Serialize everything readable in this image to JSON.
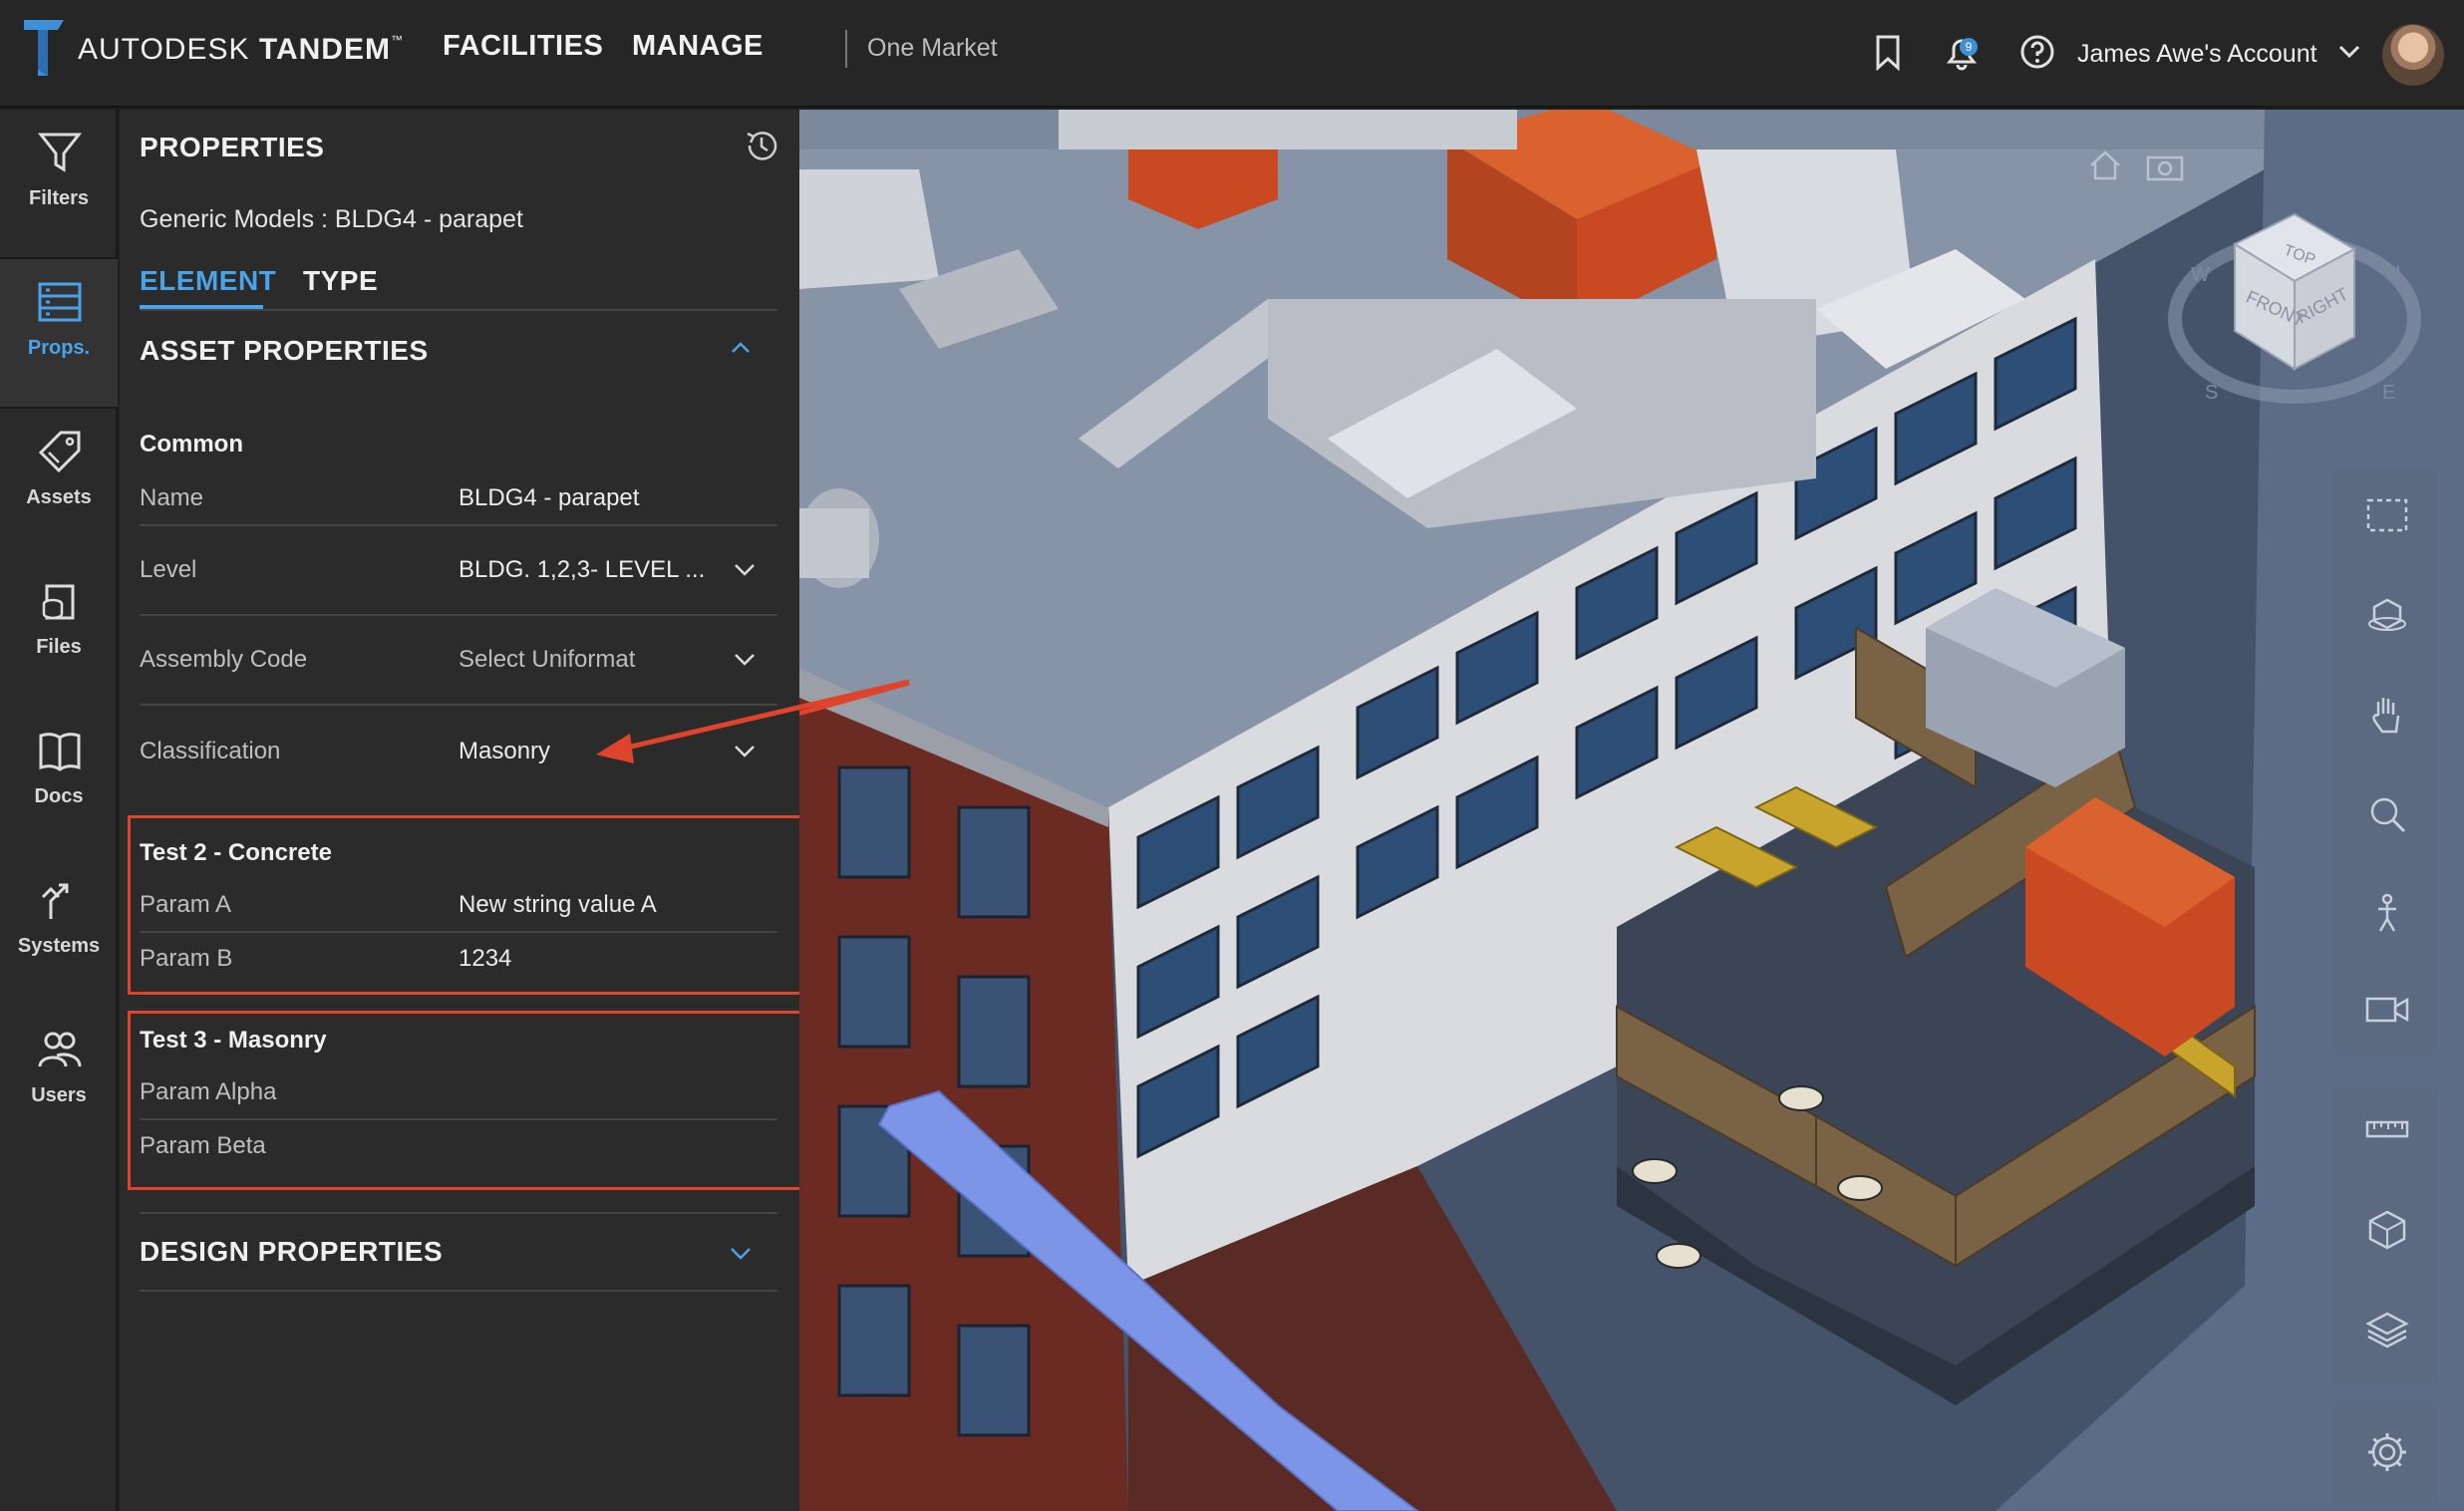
{
  "header": {
    "brand_light": "AUTODESK",
    "brand_bold": "TANDEM",
    "trademark": "™",
    "nav": [
      "FACILITIES",
      "MANAGE"
    ],
    "facility": "One Market",
    "notification_count": "9",
    "account": "James Awe's Account"
  },
  "rail": {
    "items": [
      {
        "label": "Filters",
        "icon": "filter-icon"
      },
      {
        "label": "Props.",
        "icon": "properties-icon",
        "active": true
      },
      {
        "label": "Assets",
        "icon": "tag-icon"
      },
      {
        "label": "Files",
        "icon": "database-icon"
      },
      {
        "label": "Docs",
        "icon": "book-icon"
      },
      {
        "label": "Systems",
        "icon": "systems-icon"
      },
      {
        "label": "Users",
        "icon": "users-icon"
      }
    ]
  },
  "panel": {
    "title": "PROPERTIES",
    "subtitle": "Generic Models : BLDG4 - parapet",
    "tabs": [
      "ELEMENT",
      "TYPE"
    ],
    "asset_section": "ASSET PROPERTIES",
    "common": {
      "heading": "Common",
      "rows": [
        {
          "label": "Name",
          "value": "BLDG4 - parapet"
        },
        {
          "label": "Level",
          "value": "BLDG. 1,2,3- LEVEL ..."
        },
        {
          "label": "Assembly Code",
          "value": "Select Uniformat"
        },
        {
          "label": "Classification",
          "value": "Masonry"
        }
      ]
    },
    "test2": {
      "heading": "Test 2 - Concrete",
      "rows": [
        {
          "label": "Param A",
          "value": "New string value A"
        },
        {
          "label": "Param B",
          "value": "1234"
        }
      ]
    },
    "test3": {
      "heading": "Test 3 - Masonry",
      "rows": [
        {
          "label": "Param Alpha",
          "value": ""
        },
        {
          "label": "Param Beta",
          "value": ""
        }
      ]
    },
    "design_section": "DESIGN PROPERTIES"
  },
  "viewcube": {
    "top": "TOP",
    "front": "FRONT",
    "right": "RIGHT",
    "n": "N",
    "s": "S",
    "e": "E",
    "w": "W"
  },
  "colors": {
    "accent": "#4aa3e8",
    "highlight": "#e0432b",
    "building_red": "#c94a22",
    "selection": "#7d95e6"
  }
}
